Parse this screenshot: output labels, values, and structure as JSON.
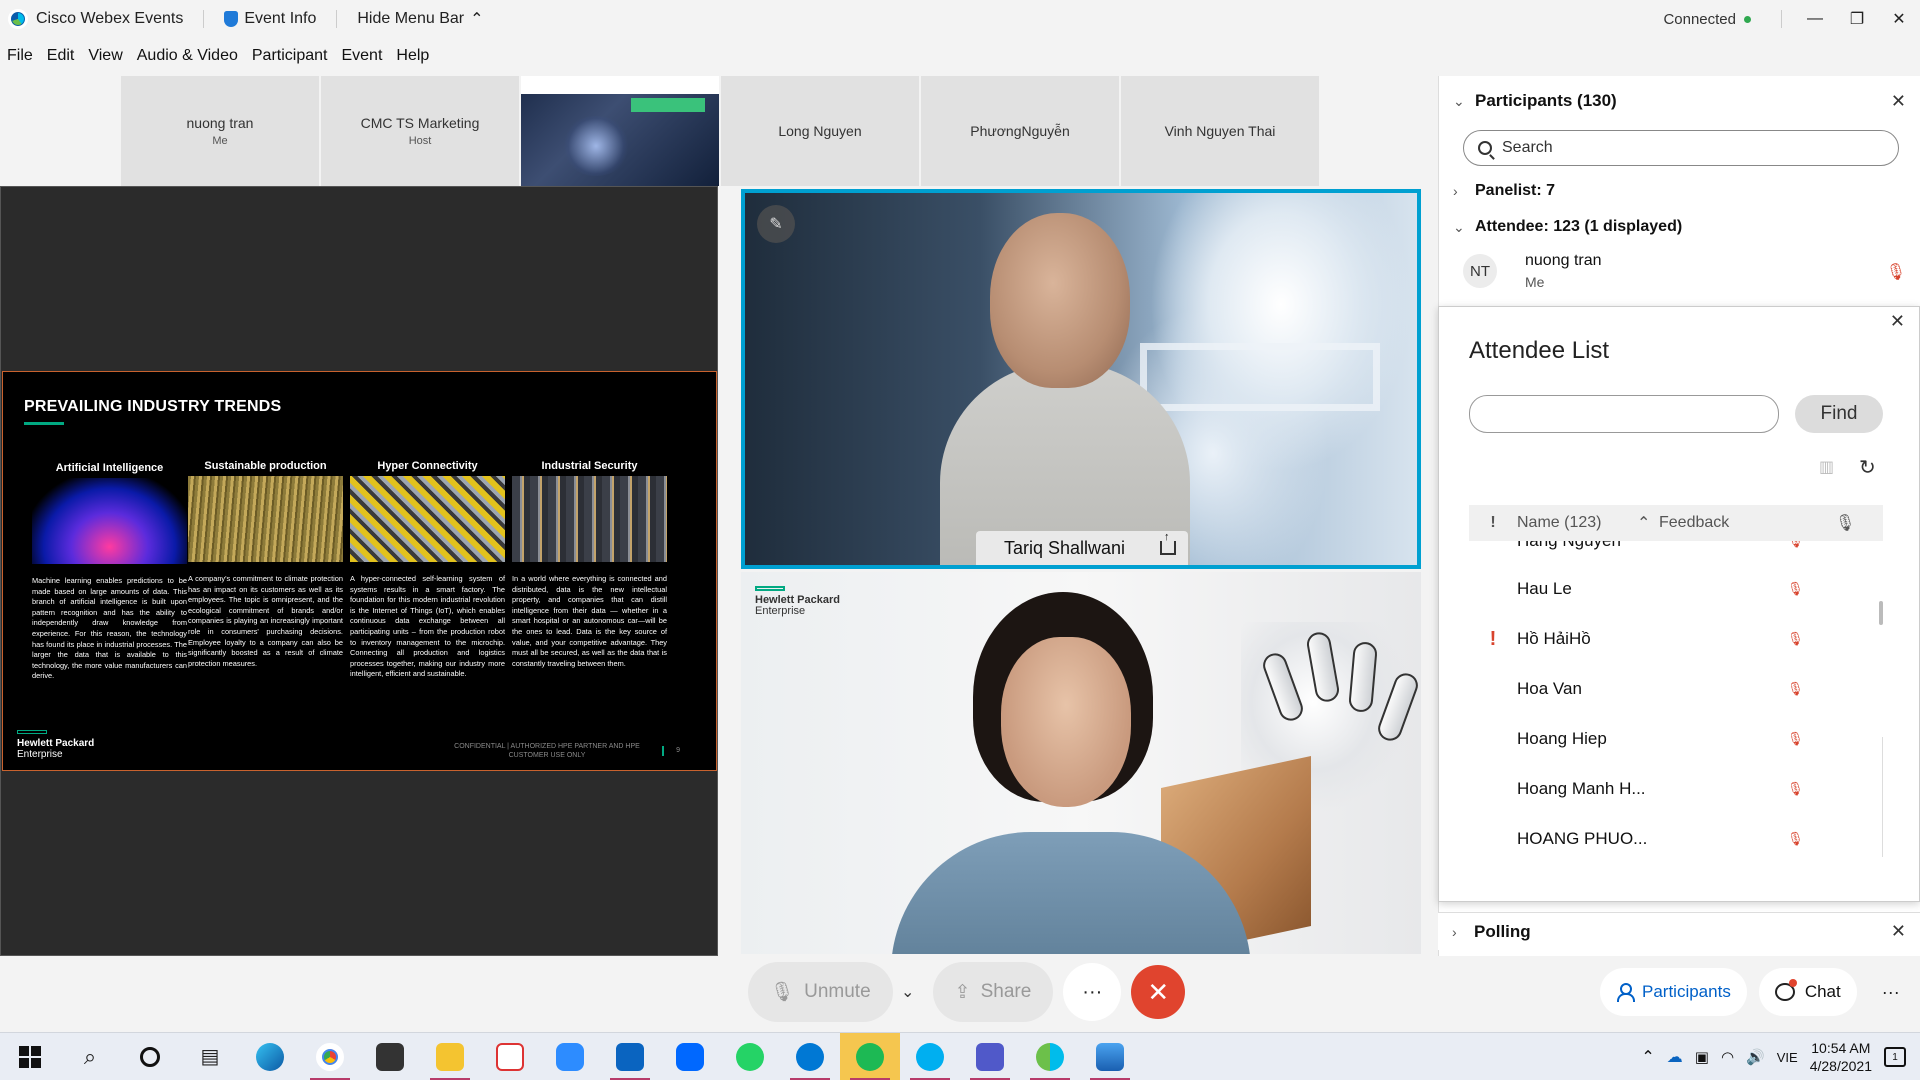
{
  "titlebar": {
    "app_name": "Cisco Webex Events",
    "event_info": "Event Info",
    "hide_menu": "Hide Menu Bar",
    "status": "Connected"
  },
  "menu": [
    "File",
    "Edit",
    "View",
    "Audio & Video",
    "Participant",
    "Event",
    "Help"
  ],
  "thumbnails": [
    {
      "name": "nuong tran",
      "sub": "Me"
    },
    {
      "name": "CMC TS Marketing",
      "sub": "Host"
    },
    {
      "name": "",
      "sub": ""
    },
    {
      "name": "Long Nguyen",
      "sub": ""
    },
    {
      "name": "PhươngNguyễn",
      "sub": ""
    },
    {
      "name": "Vinh Nguyen Thai",
      "sub": ""
    }
  ],
  "slide": {
    "title": "PREVAILING INDUSTRY TRENDS",
    "columns": [
      {
        "heading": "Artificial Intelligence",
        "text": "Machine learning enables predictions to be made based on large amounts of data. This branch of artificial intelligence is built upon pattern recognition and has the ability to independently draw knowledge from experience. For this reason, the technology has found its place in industrial processes. The larger the data that is available to this technology, the more value manufacturers can derive."
      },
      {
        "heading": "Sustainable production",
        "text": "A company's commitment to climate protection has an impact on its customers as well as its employees. The topic is omnipresent, and the ecological commitment of brands and/or companies is playing an increasingly important role in consumers' purchasing decisions. Employee loyalty to a company can also be significantly boosted as a result of climate protection measures."
      },
      {
        "heading": "Hyper Connectivity",
        "text": "A hyper-connected self-learning system of systems results in a smart factory. The foundation for this modern industrial revolution is the Internet of Things (IoT), which enables continuous data exchange between all participating units – from the production robot to inventory management to the microchip. Connecting all production and logistics processes together, making our industry more intelligent, efficient and sustainable."
      },
      {
        "heading": "Industrial Security",
        "text": "In a world where everything is connected and distributed, data is the new intellectual property, and companies that can distill intelligence from their data — whether in a smart hospital or an autonomous car—will be the ones to lead. Data is the key source of value, and your competitive advantage. They must all be secured, as well as the data that is constantly traveling between them."
      }
    ],
    "logo_line1": "Hewlett Packard",
    "logo_line2": "Enterprise",
    "confidential": "CONFIDENTIAL | AUTHORIZED HPE PARTNER AND HPE CUSTOMER USE ONLY",
    "page": "9"
  },
  "video1": {
    "name": "Tariq Shallwani"
  },
  "video2": {
    "logo_line1": "Hewlett Packard",
    "logo_line2": "Enterprise"
  },
  "participants": {
    "title": "Participants (130)",
    "search_placeholder": "Search",
    "panelist": "Panelist: 7",
    "attendee": "Attendee: 123 (1 displayed)",
    "me": {
      "initials": "NT",
      "name": "nuong tran",
      "sub": "Me"
    }
  },
  "attendee_list": {
    "title": "Attendee List",
    "find": "Find",
    "col_name": "Name (123)",
    "col_feedback": "Feedback",
    "rows": [
      {
        "name": "Hang Nguyen",
        "flag": false
      },
      {
        "name": "Hau Le",
        "flag": false
      },
      {
        "name": "Hồ HảiHồ",
        "flag": true
      },
      {
        "name": "Hoa Van",
        "flag": false
      },
      {
        "name": "Hoang Hiep",
        "flag": false
      },
      {
        "name": "Hoang Manh H...",
        "flag": false
      },
      {
        "name": "HOANG PHUO...",
        "flag": false
      }
    ]
  },
  "polling": {
    "title": "Polling"
  },
  "controls": {
    "unmute": "Unmute",
    "share": "Share",
    "participants": "Participants",
    "chat": "Chat"
  },
  "tray": {
    "lang": "VIE",
    "time": "10:54 AM",
    "date": "4/28/2021"
  }
}
